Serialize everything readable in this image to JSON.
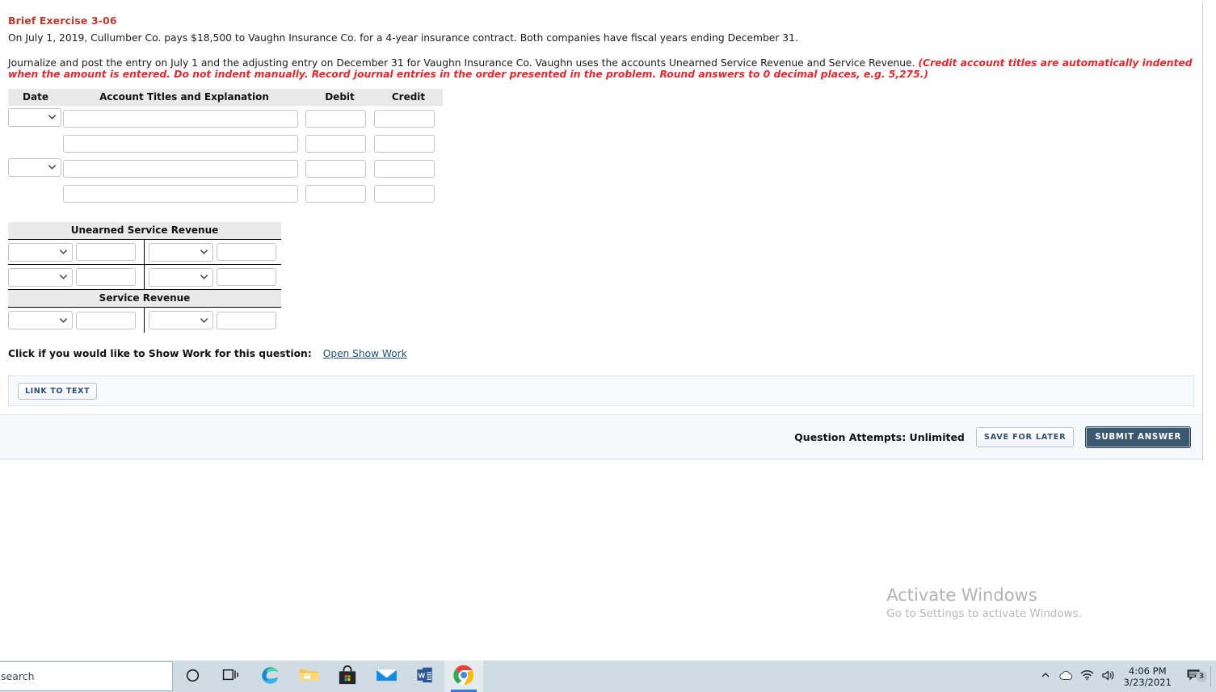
{
  "exercise": {
    "title": "Brief Exercise 3-06",
    "intro": "On July 1, 2019, Cullumber Co. pays $18,500 to Vaughn Insurance Co. for a 4-year insurance contract. Both companies have fiscal years ending December 31.",
    "instruction_plain": "Journalize and post the entry on July 1 and the adjusting entry on December 31 for Vaughn Insurance Co. Vaughn uses the accounts Unearned Service Revenue and Service Revenue. ",
    "instruction_emphasis": "(Credit account titles are automatically indented when the amount is entered. Do not indent manually. Record journal entries in the order presented in the problem. Round answers to 0 decimal places, e.g. 5,275.)"
  },
  "journal": {
    "headers": [
      "Date",
      "Account Titles and Explanation",
      "Debit",
      "Credit"
    ],
    "rows": [
      {
        "has_date_select": true,
        "date_value": "",
        "account": "",
        "debit": "",
        "credit": ""
      },
      {
        "has_date_select": false,
        "date_value": "",
        "account": "",
        "debit": "",
        "credit": ""
      },
      {
        "has_date_select": true,
        "date_value": "",
        "account": "",
        "debit": "",
        "credit": ""
      },
      {
        "has_date_select": false,
        "date_value": "",
        "account": "",
        "debit": "",
        "credit": ""
      }
    ]
  },
  "t_accounts": [
    {
      "title": "Unearned Service Revenue",
      "rows": [
        {
          "left_date": "",
          "left_amount": "",
          "right_date": "",
          "right_amount": ""
        },
        {
          "left_date": "",
          "left_amount": "",
          "right_date": "",
          "right_amount": ""
        }
      ]
    },
    {
      "title": "Service Revenue",
      "rows": [
        {
          "left_date": "",
          "left_amount": "",
          "right_date": "",
          "right_amount": ""
        }
      ]
    }
  ],
  "show_work": {
    "label": "Click if you would like to Show Work for this question:",
    "link": "Open Show Work"
  },
  "link_panel": {
    "button": "LINK TO TEXT"
  },
  "footer": {
    "attempts": "Question Attempts: Unlimited",
    "save_label": "SAVE FOR LATER",
    "submit_label": "SUBMIT ANSWER"
  },
  "watermark": {
    "title": "Activate Windows",
    "subtitle": "Go to Settings to activate Windows."
  },
  "taskbar": {
    "search_text": "search",
    "apps": [
      {
        "name": "cortana-icon",
        "active": false
      },
      {
        "name": "task-view-icon",
        "active": false
      },
      {
        "name": "microsoft-edge-icon",
        "active": false
      },
      {
        "name": "file-explorer-icon",
        "active": false
      },
      {
        "name": "microsoft-store-icon",
        "active": false
      },
      {
        "name": "mail-icon",
        "active": false
      },
      {
        "name": "microsoft-word-icon",
        "active": false
      },
      {
        "name": "google-chrome-icon",
        "active": true
      }
    ],
    "tray": {
      "show_hidden_icons": "show-hidden-icons-chevron",
      "onedrive": "onedrive-cloud-icon",
      "network": "wifi-icon",
      "volume": "speaker-icon",
      "time": "4:06 PM",
      "date": "3/23/2021",
      "notification_count": "3"
    }
  },
  "colors": {
    "title_red": "#c0392b",
    "emphasis_red": "#e8272c",
    "header_gray": "#e9e9e9",
    "submit_blue": "#3c5871",
    "link_blue": "#1f4e79",
    "taskbar": "#cfdce4"
  }
}
